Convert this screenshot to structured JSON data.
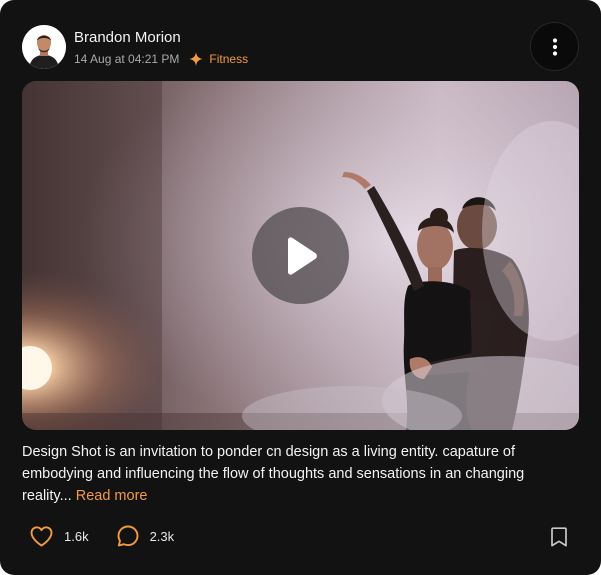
{
  "post": {
    "author": "Brandon Morion",
    "timestamp": "14 Aug at 04:21 PM",
    "category": "Fitness",
    "caption": "Design Shot is an invitation to ponder cn design as a living entity. capature of embodying and influencing the flow of thoughts and sensations in an changing reality...",
    "read_more_label": "Read more"
  },
  "stats": {
    "likes": "1.6k",
    "comments": "2.3k"
  },
  "icons": {
    "more": "more-vertical-icon",
    "category": "sparkle-icon",
    "play": "play-icon",
    "like": "heart-icon",
    "comment": "comment-bubble-icon",
    "save": "bookmark-icon"
  },
  "colors": {
    "card_bg": "#121212",
    "accent": "#f29b3c",
    "text": "#f3f3f3",
    "muted": "#a9a9a9"
  }
}
